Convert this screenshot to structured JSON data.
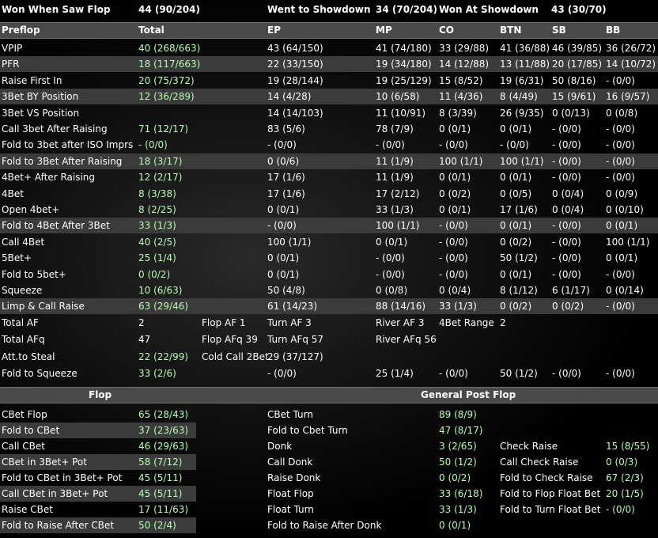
{
  "top_header": {
    "won_when_saw_flop_label": "Won When Saw Flop",
    "won_when_saw_flop_value": "44 (90/204)",
    "went_to_showdown_label": "Went to Showdown",
    "went_to_showdown_value": "34 (70/204)",
    "won_at_showdown_label": "Won At Showdown",
    "won_at_showdown_value": "43 (30/70)"
  },
  "preflop_columns": [
    "Preflop",
    "Total",
    "EP",
    "MP",
    "CO",
    "BTN",
    "SB",
    "BB"
  ],
  "preflop_rows": [
    {
      "label": "VPIP",
      "total": "40 (268/663)",
      "ep": "43 (64/150)",
      "mp": "41 (74/180)",
      "co": "33 (29/88)",
      "btn": "41 (36/88)",
      "sb": "46 (39/85)",
      "bb": "36 (26/72)"
    },
    {
      "label": "PFR",
      "total": "18 (117/663)",
      "ep": "22 (33/150)",
      "mp": "19 (34/180)",
      "co": "14 (12/88)",
      "btn": "13 (11/88)",
      "sb": "20 (17/85)",
      "bb": "14 (10/72)"
    },
    {
      "label": "Raise First In",
      "total": "20 (75/372)",
      "ep": "19 (28/144)",
      "mp": "19 (25/129)",
      "co": "15 (8/52)",
      "btn": "19 (6/31)",
      "sb": "50 (8/16)",
      "bb": "- (0/0)"
    },
    {
      "label": "3Bet BY Position",
      "total": "12 (36/289)",
      "ep": "14 (4/28)",
      "mp": "10 (6/58)",
      "co": "11 (4/36)",
      "btn": "8 (4/49)",
      "sb": "15 (9/61)",
      "bb": "16 (9/57)"
    },
    {
      "label": "3Bet VS Position",
      "total": "",
      "ep": "14 (14/103)",
      "mp": "11 (10/91)",
      "co": "8 (3/39)",
      "btn": "26 (9/35)",
      "sb": "0 (0/13)",
      "bb": "0 (0/8)"
    },
    {
      "label": "Call 3bet After Raising",
      "total": "71 (12/17)",
      "ep": "83 (5/6)",
      "mp": "78 (7/9)",
      "co": "0 (0/1)",
      "btn": "0 (0/1)",
      "sb": "- (0/0)",
      "bb": "- (0/0)"
    },
    {
      "label": "Fold to 3bet after ISO Imprs",
      "total": "- (0/0)",
      "ep": "- (0/0)",
      "mp": "- (0/0)",
      "co": "- (0/0)",
      "btn": "- (0/0)",
      "sb": "- (0/0)",
      "bb": "- (0/0)"
    },
    {
      "label": "Fold to 3Bet After Raising",
      "total": "18 (3/17)",
      "ep": "0 (0/6)",
      "mp": "11 (1/9)",
      "co": "100 (1/1)",
      "btn": "100 (1/1)",
      "sb": "- (0/0)",
      "bb": "- (0/0)"
    },
    {
      "label": "4Bet+ After Raising",
      "total": "12 (2/17)",
      "ep": "17 (1/6)",
      "mp": "11 (1/9)",
      "co": "0 (0/1)",
      "btn": "0 (0/1)",
      "sb": "- (0/0)",
      "bb": "- (0/0)"
    },
    {
      "label": "4Bet",
      "total": "8 (3/38)",
      "ep": "17 (1/6)",
      "mp": "17 (2/12)",
      "co": "0 (0/2)",
      "btn": "0 (0/5)",
      "sb": "0 (0/4)",
      "bb": "0 (0/9)"
    },
    {
      "label": "Open 4bet+",
      "total": "8 (2/25)",
      "ep": "0 (0/1)",
      "mp": "33 (1/3)",
      "co": "0 (0/1)",
      "btn": "17 (1/6)",
      "sb": "0 (0/4)",
      "bb": "0 (0/10)"
    },
    {
      "label": "Fold to 4Bet After 3Bet",
      "total": "33 (1/3)",
      "ep": "- (0/0)",
      "mp": "100 (1/1)",
      "co": "- (0/0)",
      "btn": "0 (0/1)",
      "sb": "- (0/0)",
      "bb": "0 (0/1)"
    },
    {
      "label": "Call 4Bet",
      "total": "40 (2/5)",
      "ep": "100 (1/1)",
      "mp": "0 (0/1)",
      "co": "- (0/0)",
      "btn": "0 (0/2)",
      "sb": "- (0/0)",
      "bb": "100 (1/1)"
    },
    {
      "label": "5Bet+",
      "total": "25 (1/4)",
      "ep": "0 (0/1)",
      "mp": "- (0/0)",
      "co": "- (0/0)",
      "btn": "50 (1/2)",
      "sb": "- (0/0)",
      "bb": "0 (0/1)"
    },
    {
      "label": "Fold to 5bet+",
      "total": "0 (0/2)",
      "ep": "0 (0/1)",
      "mp": "- (0/0)",
      "co": "- (0/0)",
      "btn": "0 (0/1)",
      "sb": "- (0/0)",
      "bb": "- (0/0)"
    },
    {
      "label": "Squeeze",
      "total": "10 (6/63)",
      "ep": "50 (4/8)",
      "mp": "0 (0/8)",
      "co": "0 (0/4)",
      "btn": "8 (1/12)",
      "sb": "6 (1/17)",
      "bb": "0 (0/14)"
    },
    {
      "label": "Limp & Call Raise",
      "total": "63 (29/46)",
      "ep": "61 (14/23)",
      "mp": "88 (14/16)",
      "co": "33 (1/3)",
      "btn": "0 (0/2)",
      "sb": "0 (0/2)",
      "bb": "- (0/0)"
    }
  ],
  "af": {
    "total_af_label": "Total AF",
    "total_af_value": "2",
    "flop_af": "Flop AF 1",
    "turn_af": "Turn AF 3",
    "river_af": "River AF 3",
    "fourbet_range_label": "4Bet Range",
    "fourbet_range_value": "2",
    "total_afq_label": "Total AFq",
    "total_afq_value": "47",
    "flop_afq": "Flop AFq 39",
    "turn_afq": "Turn AFq 57",
    "river_afq": "River AFq 56",
    "att_steal_label": "Att.to Steal",
    "att_steal_value": "22 (22/99)",
    "cold_call_label": "Cold Call 2Bet",
    "cold_call_value": "29 (37/127)",
    "fold_squeeze_label": "Fold to Squeeze",
    "fold_squeeze_total": "33 (2/6)",
    "fold_squeeze_ep": "- (0/0)",
    "fold_squeeze_mp": "25 (1/4)",
    "fold_squeeze_co": "- (0/0)",
    "fold_squeeze_btn": "50 (1/2)",
    "fold_squeeze_sb": "- (0/0)",
    "fold_squeeze_bb": "- (0/0)"
  },
  "postflop": {
    "flop_header": "Flop",
    "general_header": "General Post Flop",
    "flop_rows": [
      {
        "label": "CBet Flop",
        "value": "65 (28/43)"
      },
      {
        "label": "Fold to CBet",
        "value": "37 (23/63)"
      },
      {
        "label": "Call CBet",
        "value": "46 (29/63)"
      },
      {
        "label": "CBet in 3Bet+ Pot",
        "value": "58 (7/12)"
      },
      {
        "label": "Fold to CBet in 3Bet+ Pot",
        "value": "45 (5/11)"
      },
      {
        "label": "Call CBet in 3Bet+ Pot",
        "value": "45 (5/11)"
      },
      {
        "label": "Raise CBet",
        "value": "17 (11/63)"
      },
      {
        "label": "Fold to Raise After CBet",
        "value": "50 (2/4)"
      }
    ],
    "general_rows": [
      {
        "label": "CBet Turn",
        "value": "89 (8/9)"
      },
      {
        "label": "Fold to Cbet Turn",
        "value": "47 (8/17)"
      },
      {
        "label": "Donk",
        "value": "3 (2/65)"
      },
      {
        "label": "Call Donk",
        "value": "50 (1/2)"
      },
      {
        "label": "Raise Donk",
        "value": "0 (0/2)"
      },
      {
        "label": "Float Flop",
        "value": "33 (6/18)"
      },
      {
        "label": "Float Turn",
        "value": "33 (1/3)"
      },
      {
        "label": "Fold to Raise After Donk",
        "value": "0 (0/1)"
      }
    ],
    "right_rows": [
      {
        "label": "Check Raise",
        "value": "15 (8/55)"
      },
      {
        "label": "Call Check Raise",
        "value": "0 (0/3)"
      },
      {
        "label": "Fold to Check Raise",
        "value": "67 (2/3)"
      },
      {
        "label": "Fold to Flop Float Bet",
        "value": "20 (1/5)"
      },
      {
        "label": "Fold to Turn Float Bet",
        "value": "- (0/0)"
      }
    ]
  }
}
